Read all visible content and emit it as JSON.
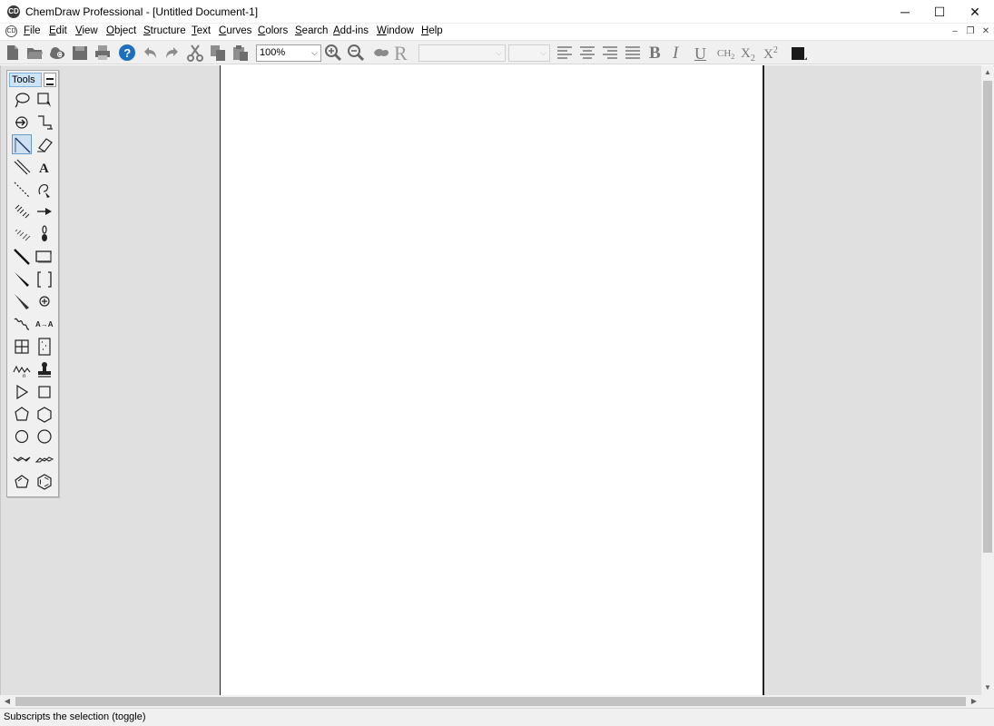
{
  "window": {
    "title": "ChemDraw Professional - [Untitled Document-1]",
    "minimize_glyph": "─",
    "maximize_glyph": "☐",
    "close_glyph": "✕"
  },
  "menubar": {
    "items": [
      "File",
      "Edit",
      "View",
      "Object",
      "Structure",
      "Text",
      "Curves",
      "Colors",
      "Search",
      "Add-ins",
      "Window",
      "Help"
    ],
    "mdi_minimize": "–",
    "mdi_restore": "❐",
    "mdi_close": "✕"
  },
  "toolbar": {
    "zoom_value": "100%",
    "font_name": "",
    "font_size": "",
    "formula_label": "CH2",
    "subscript_label": "X2",
    "superscript_label": "X2",
    "bold_label": "B",
    "italic_label": "I",
    "underline_label": "U",
    "r_label": "R",
    "current_color": "#1a1a1a"
  },
  "tools_palette": {
    "title": "Tools",
    "text_tool_label": "A",
    "atom_map_label": "A→A",
    "selected_tool": "bond-tool"
  },
  "statusbar": {
    "text": "Subscripts the selection (toggle)"
  },
  "colors": {
    "workspace": "#e0e0e0",
    "toolbar": "#f0f0f0",
    "help_blue": "#1e6fbf",
    "selection_blue": "#cfe0f3"
  }
}
